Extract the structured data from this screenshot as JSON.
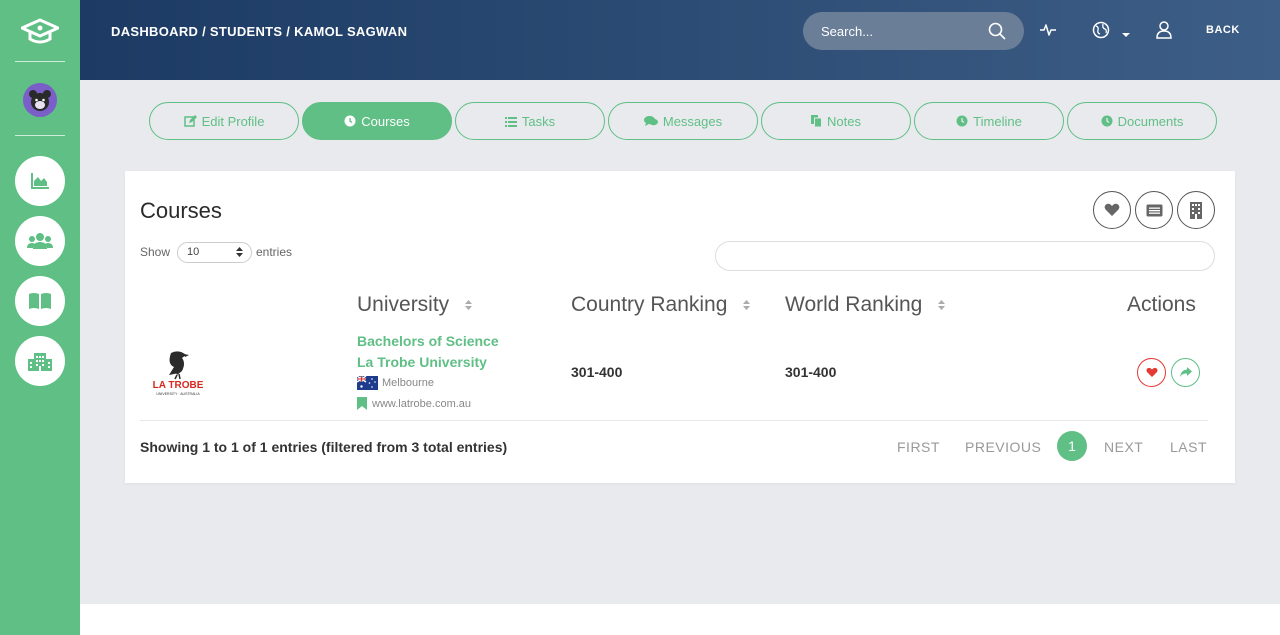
{
  "header": {
    "breadcrumb": "DASHBOARD / STUDENTS / KAMOL SAGWAN",
    "search_placeholder": "Search...",
    "back_label": "BACK"
  },
  "sidebar": {
    "items": [
      {
        "icon": "area-chart-icon"
      },
      {
        "icon": "users-icon"
      },
      {
        "icon": "book-icon"
      },
      {
        "icon": "building-icon"
      }
    ]
  },
  "tabs": [
    {
      "label": "Edit Profile",
      "icon": "edit-icon"
    },
    {
      "label": "Courses",
      "icon": "clock-icon",
      "active": true
    },
    {
      "label": "Tasks",
      "icon": "list-icon"
    },
    {
      "label": "Messages",
      "icon": "comments-icon"
    },
    {
      "label": "Notes",
      "icon": "copy-icon"
    },
    {
      "label": "Timeline",
      "icon": "clock-icon"
    },
    {
      "label": "Documents",
      "icon": "clock-icon"
    }
  ],
  "card": {
    "title": "Courses",
    "show_label": "Show",
    "entries_value": "10",
    "entries_label": "entries",
    "filter_value": ""
  },
  "table": {
    "headers": {
      "university": "University",
      "country_ranking": "Country Ranking",
      "world_ranking": "World Ranking",
      "actions": "Actions"
    },
    "rows": [
      {
        "logo_text": "LA TROBE",
        "logo_subtext": "UNIVERSITY · AUSTRALIA",
        "course": "Bachelors of Science",
        "university": "La Trobe University",
        "city": "Melbourne",
        "website": "www.latrobe.com.au",
        "country_ranking": "301-400",
        "world_ranking": "301-400"
      }
    ]
  },
  "pagination": {
    "info": "Showing 1 to 1 of 1 entries (filtered from 3 total entries)",
    "first": "FIRST",
    "previous": "PREVIOUS",
    "current": "1",
    "next": "NEXT",
    "last": "LAST"
  },
  "colors": {
    "brand_green": "#5fbf85",
    "header_dark": "#1c3a63",
    "header_light": "#3d5e86",
    "background": "#e9eaee",
    "heart_red": "#e53935"
  }
}
